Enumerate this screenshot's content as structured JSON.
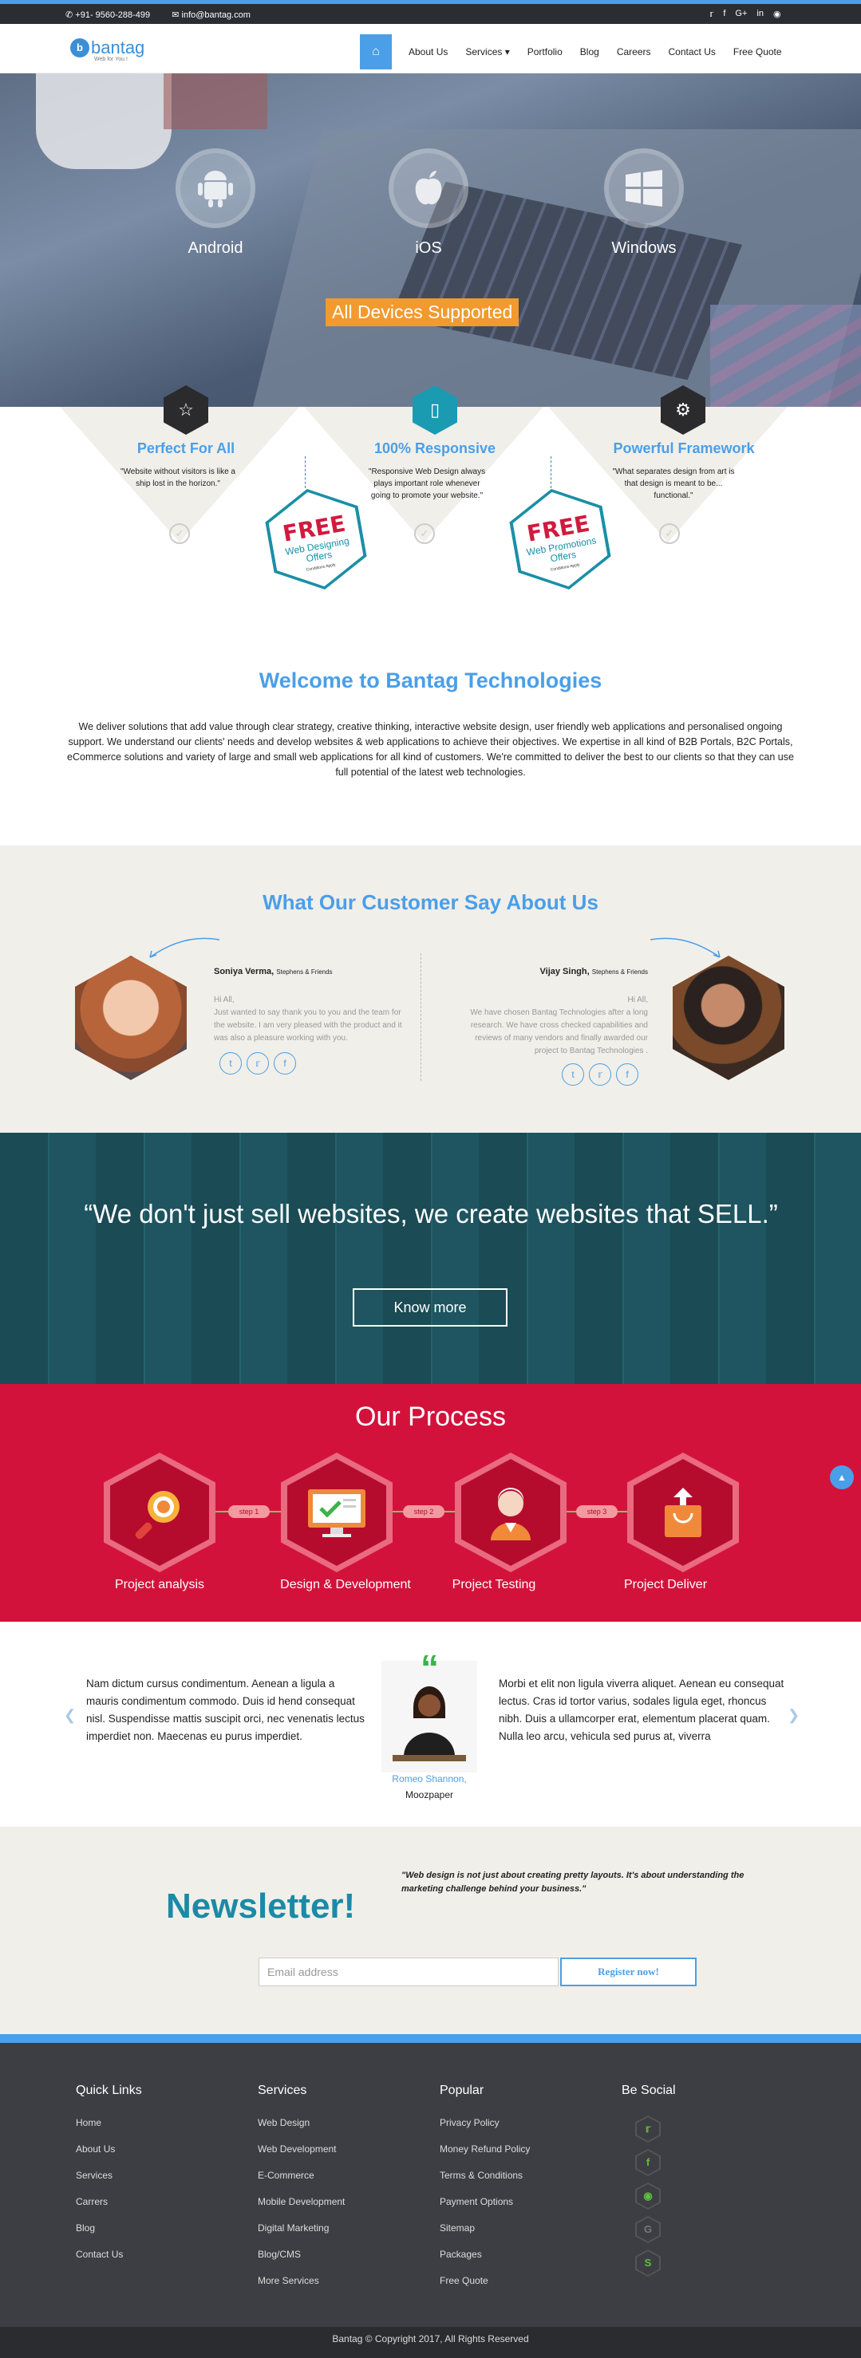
{
  "topbar": {
    "phone": "+91- 9560-288-499",
    "email": "info@bantag.com",
    "social_icons": [
      "twitter-icon",
      "facebook-icon",
      "google-plus-icon",
      "linkedin-icon",
      "instagram-icon"
    ]
  },
  "nav": {
    "logo_text": "bantag",
    "logo_tagline": "Web for You !",
    "items": [
      "About Us",
      "Services",
      "Portfolio",
      "Blog",
      "Careers",
      "Contact Us",
      "Free Quote"
    ],
    "services_caret": "▾"
  },
  "hero": {
    "platforms": [
      "Android",
      "iOS",
      "Windows"
    ],
    "badge": "All Devices Supported"
  },
  "features": [
    {
      "title": "Perfect For All",
      "quote": "\"Website without visitors is like a ship lost in the horizon.\""
    },
    {
      "title": "100% Responsive",
      "quote": "\"Responsive Web Design always plays important role whenever going to promote your website.\""
    },
    {
      "title": "Powerful Framework",
      "quote": "\"What separates design from art is that design is meant to be... functional.\""
    }
  ],
  "offers": [
    {
      "free": "FREE",
      "line1": "Web Designing",
      "line2": "Offers",
      "fine": "Conditions Apply"
    },
    {
      "free": "FREE",
      "line1": "Web Promotions",
      "line2": "Offers",
      "fine": "Conditions Apply"
    }
  ],
  "welcome": {
    "title": "Welcome to Bantag Technologies",
    "text": "We deliver solutions that add value through clear strategy, creative thinking, interactive website design, user friendly web applications and personalised ongoing support. We understand our clients' needs and develop websites & web applications to achieve their objectives. We expertise in all kind of B2B Portals, B2C Portals, eCommerce solutions and variety of large and small web applications for all kind of customers. We're committed to deliver the best to our clients so that they can use full potential of the latest web technologies."
  },
  "testimonials": {
    "title": "What Our Customer Say About Us",
    "items": [
      {
        "name": "Soniya Verma,",
        "company": "Stephens & Friends",
        "greeting": "Hi All,",
        "body": "Just wanted to say thank you to you and the team for the website. I am very pleased with the product and it was also a pleasure working with you."
      },
      {
        "name": "Vijay Singh,",
        "company": "Stephens & Friends",
        "greeting": "Hi All,",
        "body": "We have chosen Bantag Technologies after a long research. We have cross checked capabilities and reviews of many vendors and finally awarded our project to Bantag Technologies ."
      }
    ],
    "social": [
      "t",
      "🐦",
      "f"
    ]
  },
  "band": {
    "quote": "“We don't just sell websites, we create websites that SELL.”",
    "button": "Know more"
  },
  "process": {
    "title": "Our Process",
    "steps": [
      {
        "label": "Project analysis",
        "step": "step 1"
      },
      {
        "label": "Design & Development",
        "step": "step 2"
      },
      {
        "label": "Project Testing",
        "step": "step 3"
      },
      {
        "label": "Project Deliver",
        "step": ""
      }
    ]
  },
  "testimonial2": {
    "left": "Nam dictum cursus condimentum. Aenean a ligula a mauris condimentum commodo. Duis id hend consequat nisl. Suspendisse mattis suscipit orci, nec venenatis lectus imperdiet non. Maecenas eu purus imperdiet.",
    "right": "Morbi et elit non ligula viverra aliquet. Aenean eu consequat lectus. Cras id tortor varius, sodales ligula eget, rhoncus nibh. Duis a ullamcorper erat, elementum placerat quam. Nulla leo arcu, vehicula sed purus at, viverra",
    "name": "Romeo Shannon,",
    "company": "Moozpaper",
    "quote_mark": "“"
  },
  "newsletter": {
    "title": "Newsletter!",
    "quote": "\"Web design is not just about creating pretty layouts. It's about understanding the marketing challenge behind your business.\"",
    "placeholder": "Email address",
    "button": "Register now!"
  },
  "footer": {
    "quick_links": {
      "title": "Quick Links",
      "items": [
        "Home",
        "About Us",
        "Services",
        "Carrers",
        "Blog",
        "Contact Us"
      ]
    },
    "services": {
      "title": "Services",
      "items": [
        "Web Design",
        "Web Development",
        "E-Commerce",
        "Mobile Development",
        "Digital Marketing",
        "Blog/CMS",
        "More Services"
      ]
    },
    "popular": {
      "title": "Popular",
      "items": [
        "Privacy Policy",
        "Money Refund Policy",
        "Terms & Conditions",
        "Payment Options",
        "Sitemap",
        "Packages",
        "Free Quote"
      ]
    },
    "social": {
      "title": "Be Social",
      "icons": [
        "twitter-icon",
        "facebook-icon",
        "instagram-icon",
        "google-icon",
        "skype-icon"
      ]
    },
    "copyright": "Bantag © Copyright 2017, All Rights Reserved"
  },
  "colors": {
    "accent": "#4a9fe8",
    "process": "#d3123b",
    "teal": "#1b8aa6",
    "footer": "#3d3e43"
  }
}
